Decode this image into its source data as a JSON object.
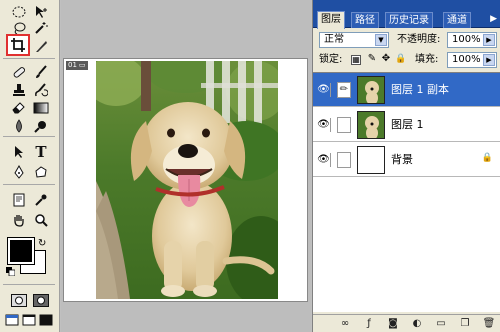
{
  "doc": {
    "tab_label": "01"
  },
  "panel": {
    "tabs": [
      "图层",
      "路径",
      "历史记录",
      "通道"
    ],
    "blend_mode": "正常",
    "opacity_label": "不透明度:",
    "opacity_value": "100%",
    "lock_label": "锁定:",
    "fill_label": "填充:",
    "fill_value": "100%",
    "layers": [
      {
        "name": "图层 1 副本",
        "selected": true
      },
      {
        "name": "图层 1",
        "selected": false
      },
      {
        "name": "背景",
        "selected": false
      }
    ]
  },
  "colors": {
    "foreground": "#000000",
    "background": "#ffffff",
    "selection_blue": "#3169c6",
    "panel_header_blue": "#1f4fa3",
    "active_tool_outline": "#e03030"
  },
  "tools": [
    "marquee-icon",
    "move-icon",
    "lasso-icon",
    "magic-wand-icon",
    "crop-icon",
    "slice-icon",
    "healing-brush-icon",
    "brush-icon",
    "clone-stamp-icon",
    "history-brush-icon",
    "eraser-icon",
    "gradient-icon",
    "blur-icon",
    "dodge-icon",
    "path-select-icon",
    "type-icon",
    "pen-icon",
    "shape-icon",
    "notes-icon",
    "eyedropper-icon",
    "hand-icon",
    "zoom-icon",
    "quick-mask-off-icon",
    "quick-mask-on-icon",
    "screen-mode-icon"
  ]
}
